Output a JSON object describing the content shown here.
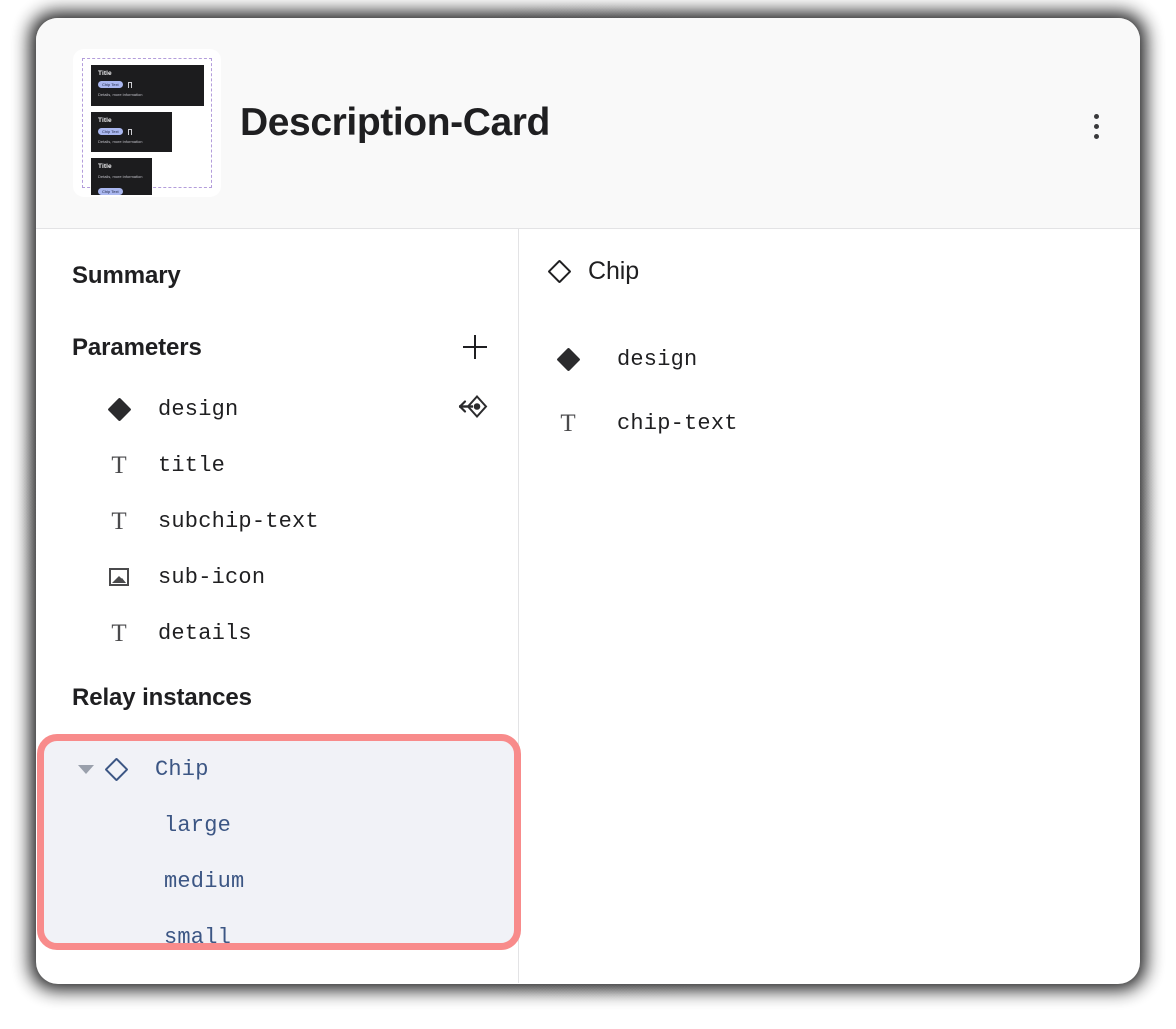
{
  "header": {
    "title": "Description-Card",
    "menu_icon": "kebab-menu-icon",
    "thumbnail": {
      "cards": [
        {
          "title": "Title",
          "chip": "Chip Text",
          "details": "Details, more information",
          "icon": "bookmark-icon",
          "size": "large"
        },
        {
          "title": "Title",
          "chip": "Chip Text",
          "details": "Details, more information",
          "icon": "bookmark-icon",
          "size": "medium"
        },
        {
          "title": "Title",
          "chip": "Chip Text",
          "details": "Details, more information",
          "icon": "",
          "size": "small"
        }
      ]
    }
  },
  "left_pane": {
    "summary_label": "Summary",
    "parameters_label": "Parameters",
    "add_parameter_icon": "plus-icon",
    "parameters": [
      {
        "name": "design",
        "icon": "diamond-filled-icon",
        "trailing_icon": "instance-swap-icon"
      },
      {
        "name": "title",
        "icon": "text-icon",
        "trailing_icon": ""
      },
      {
        "name": "subchip-text",
        "icon": "text-icon",
        "trailing_icon": ""
      },
      {
        "name": "sub-icon",
        "icon": "image-icon",
        "trailing_icon": ""
      },
      {
        "name": "details",
        "icon": "text-icon",
        "trailing_icon": ""
      }
    ],
    "relay_instances_label": "Relay instances",
    "relay_instances": [
      {
        "name": "Chip",
        "icon": "diamond-outline-icon",
        "expanded": true,
        "child": false
      },
      {
        "name": "large",
        "icon": "",
        "expanded": false,
        "child": true
      },
      {
        "name": "medium",
        "icon": "",
        "expanded": false,
        "child": true
      },
      {
        "name": "small",
        "icon": "",
        "expanded": false,
        "child": true
      }
    ]
  },
  "right_pane": {
    "header_label": "Chip",
    "header_icon": "diamond-outline-icon",
    "items": [
      {
        "name": "design",
        "icon": "diamond-filled-icon"
      },
      {
        "name": "chip-text",
        "icon": "text-icon"
      }
    ]
  },
  "colors": {
    "highlight_border": "#f88b8b",
    "highlight_bg": "#f1f2f7",
    "relay_text": "#3c5684",
    "header_bg": "#f9f9f9",
    "chip_bg": "#aab7ef",
    "mini_card_bg": "#1c1c1e",
    "dashed_border": "#b39ddb",
    "divider": "#e3e3e5"
  }
}
